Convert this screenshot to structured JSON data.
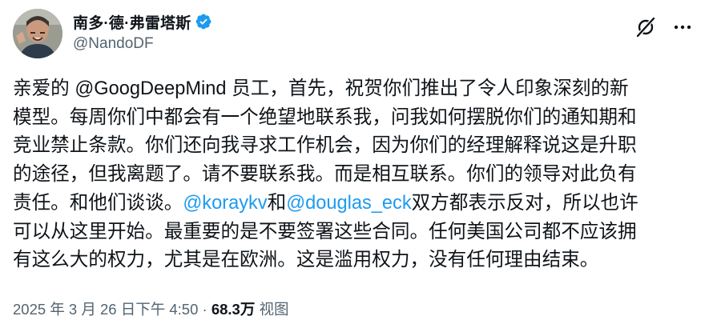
{
  "author": {
    "display_name": "南多·德·弗雷塔斯",
    "handle": "@NandoDF",
    "verified_icon": "verified-badge-icon",
    "verified_color": "#1d9bf0"
  },
  "actions": {
    "grok_icon": "grok-icon",
    "more_icon": "more-options-icon"
  },
  "tweet": {
    "line1": "亲爱的 @GoogDeepMind 员工，首先，祝贺你们推出了令人印象深刻的新",
    "line2": "模型。每周你们中都会有一个绝望地联系我，问我如何摆脱你们的通知期和",
    "line3": "竞业禁止条款。你们还向我寻求工作机会，因为你们的经理解释说这是升职",
    "line4": "的途径，但我离题了。请不要联系我。而是相互联系。你们的领导对此负有",
    "line5_pre": "责任。和他们谈谈。",
    "mention1": "@koraykv",
    "line5_mid": "和",
    "mention2": "@douglas_eck",
    "line5_post": "双方都表示反对，所以也许",
    "line6": "可以从这里开始。最重要的是不要签署这些合同。任何美国公司都不应该拥",
    "line7": "有这么大的权力，尤其是在欧洲。这是滥用权力，没有任何理由结束。"
  },
  "meta": {
    "timestamp": "2025 年 3 月 26 日下午 4:50",
    "separator": " · ",
    "views_count": "68.3万",
    "views_label": " 视图"
  },
  "colors": {
    "link": "#1d9bf0",
    "text": "#0f1419",
    "secondary": "#536471"
  }
}
